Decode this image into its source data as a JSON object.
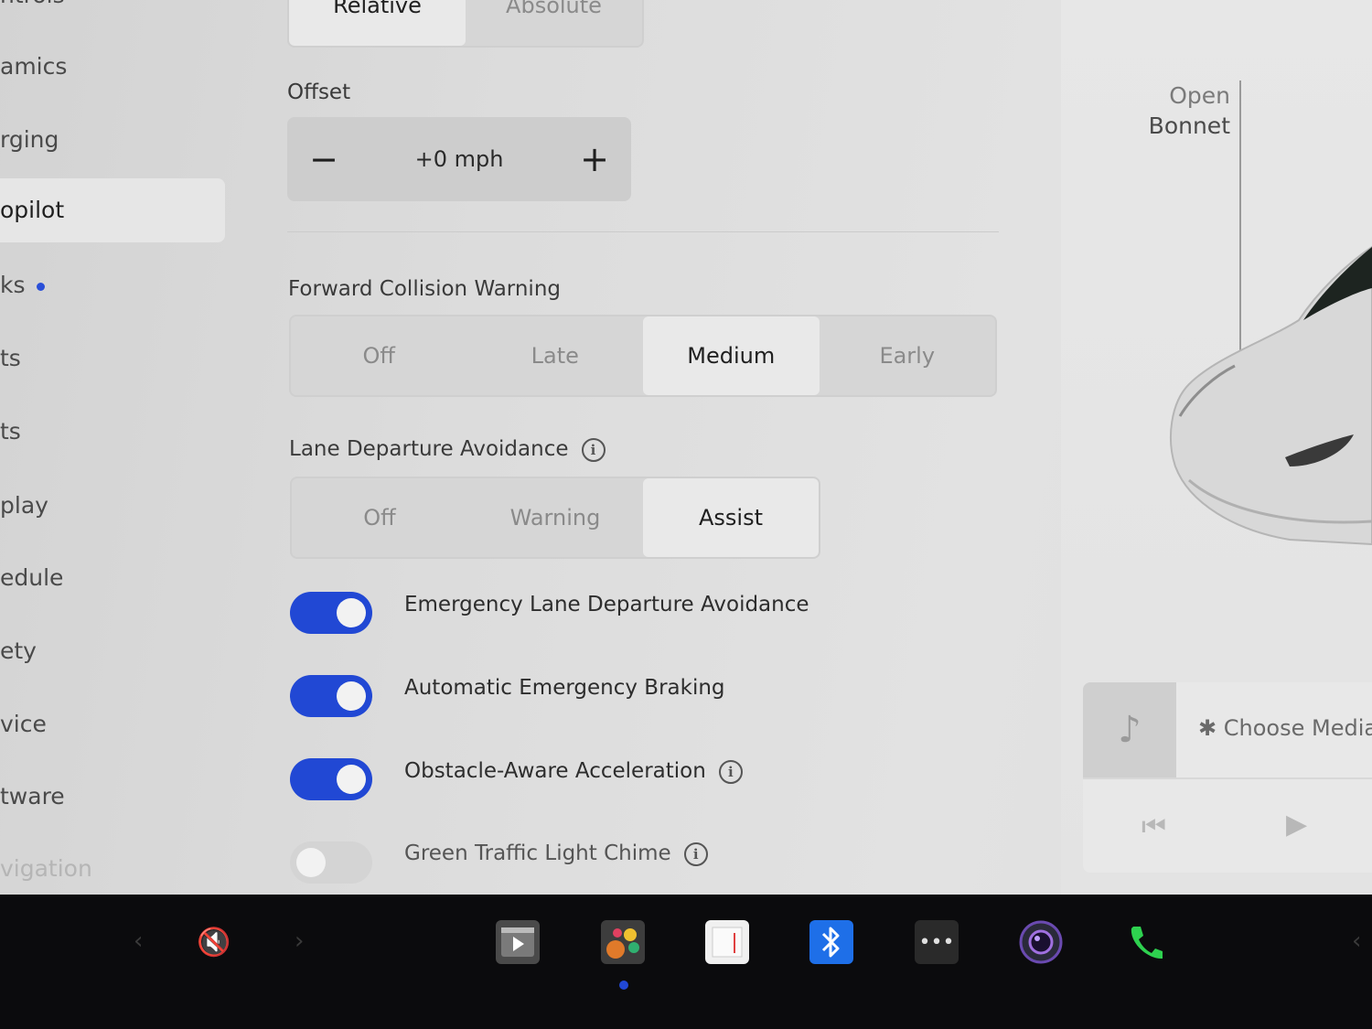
{
  "sidebar": {
    "items": [
      {
        "label": "ntrols"
      },
      {
        "label": "amics"
      },
      {
        "label": "rging"
      },
      {
        "label": "opilot"
      },
      {
        "label": "ks"
      },
      {
        "label": "ts"
      },
      {
        "label": "ts"
      },
      {
        "label": "play"
      },
      {
        "label": "edule"
      },
      {
        "label": "ety"
      },
      {
        "label": "vice"
      },
      {
        "label": "tware"
      },
      {
        "label": "vigation"
      }
    ]
  },
  "speed_mode": {
    "options": [
      "Relative",
      "Absolute"
    ],
    "selected": "Relative"
  },
  "offset": {
    "label": "Offset",
    "minus": "−",
    "value": "+0 mph",
    "plus": "+"
  },
  "fcw": {
    "label": "Forward Collision Warning",
    "options": [
      "Off",
      "Late",
      "Medium",
      "Early"
    ],
    "selected": "Medium"
  },
  "lda": {
    "label": "Lane Departure Avoidance",
    "info": "i",
    "options": [
      "Off",
      "Warning",
      "Assist"
    ],
    "selected": "Assist"
  },
  "toggles": [
    {
      "label": "Emergency Lane Departure Avoidance",
      "on": true
    },
    {
      "label": "Automatic Emergency Braking",
      "on": true
    },
    {
      "label": "Obstacle-Aware Acceleration",
      "on": true,
      "info": "i"
    },
    {
      "label": "Green Traffic Light Chime",
      "on": false,
      "info": "i"
    }
  ],
  "right_panel": {
    "open_line1": "Open",
    "open_line2": "Bonnet",
    "media": {
      "choose": "Choose Media",
      "bt_symbol": "✱"
    }
  },
  "taskbar": {
    "mute_icon": "🔇",
    "colors": {
      "accent": "#2148d4",
      "phone": "#2ed14f",
      "bluetooth": "#1e6fe8"
    }
  }
}
